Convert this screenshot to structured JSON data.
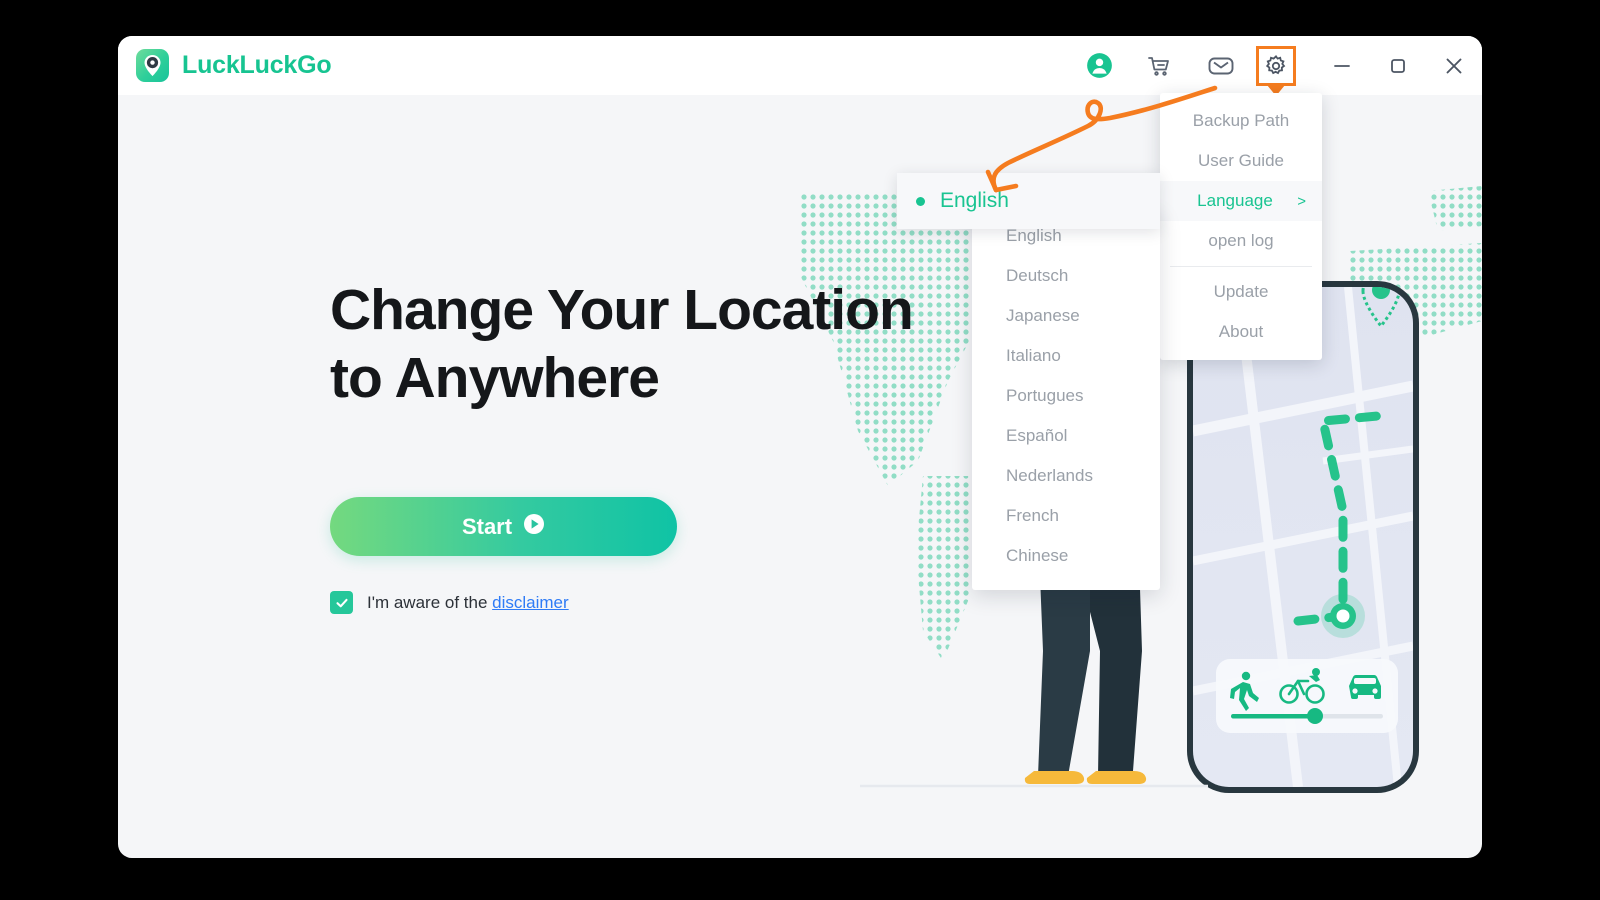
{
  "app": {
    "title": "LuckLuckGo",
    "logo_icon": "location-pin-logo-icon"
  },
  "titlebar": {
    "account_icon": "account-circle-icon",
    "cart_icon": "shopping-cart-icon",
    "mail_icon": "mail-icon",
    "settings_icon": "gear-icon",
    "minimize_icon": "minimize-icon",
    "maximize_icon": "maximize-icon",
    "close_icon": "close-icon"
  },
  "hero": {
    "line1": "Change Your Location",
    "line2": "to Anywhere",
    "start_label": "Start",
    "start_icon": "play-icon",
    "disclaimer_prefix": "I'm aware of the",
    "disclaimer_link": "disclaimer",
    "checkbox_checked": true
  },
  "settings_menu": {
    "items": [
      {
        "label": "Backup Path",
        "active": false,
        "has_submenu": false
      },
      {
        "label": "User Guide",
        "active": false,
        "has_submenu": false
      },
      {
        "label": "Language",
        "active": true,
        "has_submenu": true,
        "chevron": ">"
      },
      {
        "label": "open log",
        "active": false,
        "has_submenu": false
      },
      {
        "label": "Update",
        "active": false,
        "has_submenu": false
      },
      {
        "label": "About",
        "active": false,
        "has_submenu": false
      }
    ]
  },
  "language_menu": {
    "selected": "English",
    "items": [
      "English",
      "Deutsch",
      "Japanese",
      "Italiano",
      "Portugues",
      "Español",
      "Nederlands",
      "French",
      "Chinese"
    ]
  },
  "phone": {
    "transport_modes": [
      "walk-icon",
      "bicycle-icon",
      "car-icon"
    ],
    "slider_percent": 55
  },
  "colors": {
    "accent_green": "#19c491",
    "brand_green": "#17c491",
    "annotation_orange": "#f57c1f",
    "link_blue": "#2e7bf6",
    "window_bg": "#f5f6f8",
    "titlebar_bg": "#ffffff",
    "heading_text": "#15171a",
    "menu_text": "#9aa0a8"
  }
}
